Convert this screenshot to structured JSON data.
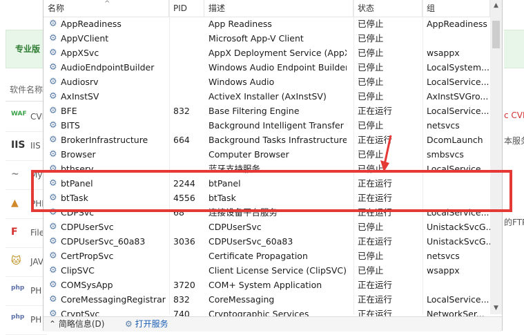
{
  "background_app": {
    "pro_label": "专业版",
    "list_header": "软件名称",
    "rows": [
      {
        "icon": "WAF",
        "text": "CVE",
        "color": "#3aa34a"
      },
      {
        "icon": "IIS",
        "text": "IIS",
        "color": "#333333"
      },
      {
        "icon": "~",
        "text": "My",
        "color": "#888888"
      },
      {
        "icon": "▲",
        "text": "PHP",
        "color": "#d08a2a"
      },
      {
        "icon": "F",
        "text": "File",
        "color": "#d32f2f"
      },
      {
        "icon": "🐱",
        "text": "JAV",
        "color": "#b8860b"
      },
      {
        "icon": "php",
        "text": "PH",
        "color": "#5b6fa8"
      },
      {
        "icon": "php",
        "text": "PH",
        "color": "#5b6fa8"
      }
    ],
    "right_texts": [
      {
        "text": "c CVE",
        "color": "#d32f2f"
      },
      {
        "text": "本服务",
        "color": "#555555"
      },
      {
        "text": "的FTP组",
        "color": "#555555"
      }
    ]
  },
  "services": {
    "columns": {
      "name": "名称",
      "pid": "PID",
      "desc": "描述",
      "status": "状态",
      "group": "组"
    },
    "rows": [
      {
        "name": "AppReadiness",
        "pid": "",
        "desc": "App Readiness",
        "status": "已停止",
        "group": "AppReadiness"
      },
      {
        "name": "AppVClient",
        "pid": "",
        "desc": "Microsoft App-V Client",
        "status": "已停止",
        "group": ""
      },
      {
        "name": "AppXSvc",
        "pid": "",
        "desc": "AppX Deployment Service (AppX...",
        "status": "已停止",
        "group": "wsappx"
      },
      {
        "name": "AudioEndpointBuilder",
        "pid": "",
        "desc": "Windows Audio Endpoint Builder",
        "status": "已停止",
        "group": "LocalSystem..."
      },
      {
        "name": "Audiosrv",
        "pid": "",
        "desc": "Windows Audio",
        "status": "已停止",
        "group": "LocalService..."
      },
      {
        "name": "AxInstSV",
        "pid": "",
        "desc": "ActiveX Installer (AxInstSV)",
        "status": "已停止",
        "group": "AxInstSVGro..."
      },
      {
        "name": "BFE",
        "pid": "832",
        "desc": "Base Filtering Engine",
        "status": "正在运行",
        "group": "LocalService..."
      },
      {
        "name": "BITS",
        "pid": "",
        "desc": "Background Intelligent Transfer ...",
        "status": "已停止",
        "group": "netsvcs"
      },
      {
        "name": "BrokerInfrastructure",
        "pid": "664",
        "desc": "Background Tasks Infrastructure...",
        "status": "正在运行",
        "group": "DcomLaunch"
      },
      {
        "name": "Browser",
        "pid": "",
        "desc": "Computer Browser",
        "status": "已停止",
        "group": "smbsvcs"
      },
      {
        "name": "bthserv",
        "pid": "",
        "desc": "蓝牙支持服务",
        "status": "已停止",
        "group": "LocalService..."
      },
      {
        "name": "btPanel",
        "pid": "2244",
        "desc": "btPanel",
        "status": "正在运行",
        "group": ""
      },
      {
        "name": "btTask",
        "pid": "4556",
        "desc": "btTask",
        "status": "正在运行",
        "group": ""
      },
      {
        "name": "CDPSvc",
        "pid": "68",
        "desc": "连接设备平台服务",
        "status": "正在运行",
        "group": "LocalService..."
      },
      {
        "name": "CDPUserSvc",
        "pid": "",
        "desc": "CDPUserSvc",
        "status": "已停止",
        "group": "UnistackSvcG..."
      },
      {
        "name": "CDPUserSvc_60a83",
        "pid": "3036",
        "desc": "CDPUserSvc_60a83",
        "status": "正在运行",
        "group": "UnistackSvcG..."
      },
      {
        "name": "CertPropSvc",
        "pid": "",
        "desc": "Certificate Propagation",
        "status": "已停止",
        "group": "netsvcs"
      },
      {
        "name": "ClipSVC",
        "pid": "",
        "desc": "Client License Service (ClipSVC)",
        "status": "已停止",
        "group": "wsappx"
      },
      {
        "name": "COMSysApp",
        "pid": "3720",
        "desc": "COM+ System Application",
        "status": "正在运行",
        "group": ""
      },
      {
        "name": "CoreMessagingRegistrar",
        "pid": "832",
        "desc": "CoreMessaging",
        "status": "正在运行",
        "group": "LocalService..."
      },
      {
        "name": "CryptSvc",
        "pid": "740",
        "desc": "Cryptographic Services",
        "status": "正在运行",
        "group": "NetworkSer..."
      }
    ]
  },
  "footer": {
    "brief_info": "简略信息(D)",
    "open_services": "打开服务"
  },
  "colors": {
    "highlight": "#e53935",
    "link": "#1a5fb4",
    "gear": "#5a7ea8"
  }
}
